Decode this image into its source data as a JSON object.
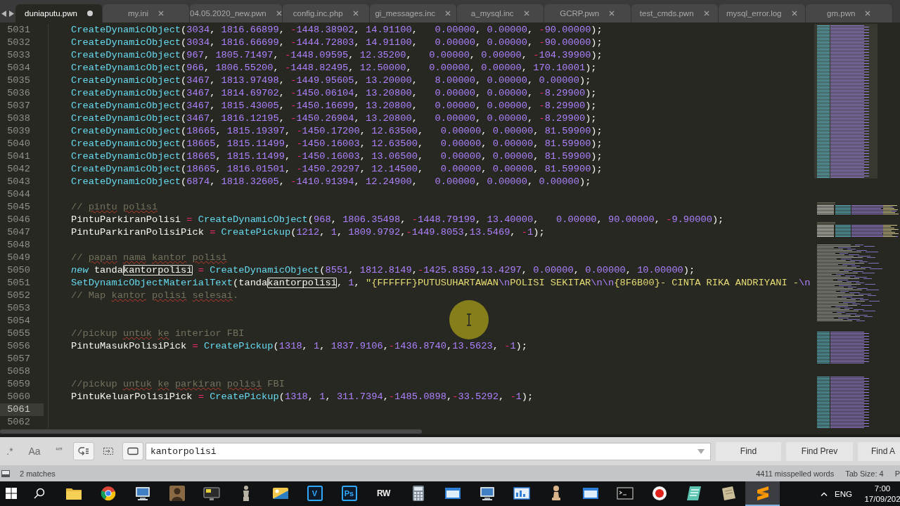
{
  "tabs": [
    {
      "label": "duniaputu.pwn",
      "selected": true,
      "modified": true
    },
    {
      "label": "my.ini",
      "selected": false,
      "modified": false
    },
    {
      "label": "04.05.2020_new.pwn",
      "selected": false,
      "modified": false
    },
    {
      "label": "config.inc.php",
      "selected": false,
      "modified": false
    },
    {
      "label": "gi_messages.inc",
      "selected": false,
      "modified": false
    },
    {
      "label": "a_mysql.inc",
      "selected": false,
      "modified": false
    },
    {
      "label": "GCRP.pwn",
      "selected": false,
      "modified": false
    },
    {
      "label": "test_cmds.pwn",
      "selected": false,
      "modified": false
    },
    {
      "label": "mysql_error.log",
      "selected": false,
      "modified": false
    },
    {
      "label": "gm.pwn",
      "selected": false,
      "modified": false
    }
  ],
  "editor": {
    "lines": [
      {
        "number": "5031",
        "current": false,
        "segments": [
          {
            "kind": "code",
            "text": "CreateDynamicObject(3034, 1816.66899, -1448.38902, 14.91100,   0.00000, 0.00000, -90.00000);",
            "match": false
          }
        ]
      },
      {
        "number": "5032",
        "current": false,
        "segments": [
          {
            "kind": "code",
            "text": "CreateDynamicObject(3034, 1816.66699, -1444.72803, 14.91100,   0.00000, 0.00000, -90.00000);",
            "match": false
          }
        ]
      },
      {
        "number": "5033",
        "current": false,
        "segments": [
          {
            "kind": "code",
            "text": "CreateDynamicObject(967, 1805.71497, -1448.09595, 12.35200,   0.00000, 0.00000, -104.39900);",
            "match": false
          }
        ]
      },
      {
        "number": "5034",
        "current": false,
        "segments": [
          {
            "kind": "code",
            "text": "CreateDynamicObject(966, 1806.55200, -1448.82495, 12.50000,   0.00000, 0.00000, 170.10001);",
            "match": false
          }
        ]
      },
      {
        "number": "5035",
        "current": false,
        "segments": [
          {
            "kind": "code",
            "text": "CreateDynamicObject(3467, 1813.97498, -1449.95605, 13.20000,   8.00000, 0.00000, 0.00000);",
            "match": false
          }
        ]
      },
      {
        "number": "5036",
        "current": false,
        "segments": [
          {
            "kind": "code",
            "text": "CreateDynamicObject(3467, 1814.69702, -1450.06104, 13.20800,   0.00000, 0.00000, -8.29900);",
            "match": false
          }
        ]
      },
      {
        "number": "5037",
        "current": false,
        "segments": [
          {
            "kind": "code",
            "text": "CreateDynamicObject(3467, 1815.43005, -1450.16699, 13.20800,   0.00000, 0.00000, -8.29900);",
            "match": false
          }
        ]
      },
      {
        "number": "5038",
        "current": false,
        "segments": [
          {
            "kind": "code",
            "text": "CreateDynamicObject(3467, 1816.12195, -1450.26904, 13.20800,   0.00000, 0.00000, -8.29900);",
            "match": false
          }
        ]
      },
      {
        "number": "5039",
        "current": false,
        "segments": [
          {
            "kind": "code",
            "text": "CreateDynamicObject(18665, 1815.19397, -1450.17200, 12.63500,   0.00000, 0.00000, 81.59900);",
            "match": false
          }
        ]
      },
      {
        "number": "5040",
        "current": false,
        "segments": [
          {
            "kind": "code",
            "text": "CreateDynamicObject(18665, 1815.11499, -1450.16003, 12.63500,   0.00000, 0.00000, 81.59900);",
            "match": false
          }
        ]
      },
      {
        "number": "5041",
        "current": false,
        "segments": [
          {
            "kind": "code",
            "text": "CreateDynamicObject(18665, 1815.11499, -1450.16003, 13.06500,   0.00000, 0.00000, 81.59900);",
            "match": false
          }
        ]
      },
      {
        "number": "5042",
        "current": false,
        "segments": [
          {
            "kind": "code",
            "text": "CreateDynamicObject(18665, 1816.01501, -1450.29297, 12.14500,   0.00000, 0.00000, 81.59900);",
            "match": false
          }
        ]
      },
      {
        "number": "5043",
        "current": false,
        "segments": [
          {
            "kind": "code",
            "text": "CreateDynamicObject(6874, 1818.32605, -1410.91394, 12.24900,   0.00000, 0.00000, 0.00000);",
            "match": false
          }
        ]
      },
      {
        "number": "5044",
        "current": false
      },
      {
        "number": "5045",
        "current": false,
        "segments": [
          {
            "kind": "comment",
            "text": "// ",
            "misspelled": false
          },
          {
            "kind": "comment",
            "text": "pintu ",
            "misspelled": true
          },
          {
            "kind": "comment",
            "text": "polisi",
            "misspelled": true
          }
        ]
      },
      {
        "number": "5046",
        "current": false,
        "segments": [
          {
            "kind": "code",
            "text": "PintuParkiranPolisi = CreateDynamicObject(968, 1806.35498, -1448.79199, 13.40000,   0.00000, 90.00000, -9.90000);",
            "match": false
          }
        ]
      },
      {
        "number": "5047",
        "current": false,
        "segments": [
          {
            "kind": "code",
            "text": "PintuParkiranPolisiPick = CreatePickup(1212, 1, 1809.9792,-1449.8053,13.5469, -1);",
            "match": false
          }
        ]
      },
      {
        "number": "5048",
        "current": false
      },
      {
        "number": "5049",
        "current": false,
        "segments": [
          {
            "kind": "comment",
            "text": "// ",
            "misspelled": false
          },
          {
            "kind": "comment",
            "text": "papan ",
            "misspelled": true
          },
          {
            "kind": "comment",
            "text": "nama ",
            "misspelled": true
          },
          {
            "kind": "comment",
            "text": "kantor ",
            "misspelled": true
          },
          {
            "kind": "comment",
            "text": "polisi",
            "misspelled": true
          }
        ]
      },
      {
        "number": "5050",
        "current": false,
        "segments": [
          {
            "kind": "keyword",
            "text": "new"
          },
          {
            "kind": "code",
            "text": " tanda",
            "match": false
          },
          {
            "kind": "code",
            "text": "kantorpolisi",
            "match": true
          },
          {
            "kind": "code",
            "text": " = CreateDynamicObject(8551, 1812.8149,-1425.8359,13.4297, 0.00000, 0.00000, 10.00000);",
            "match": false
          }
        ]
      },
      {
        "number": "5051",
        "current": false,
        "segments": [
          {
            "kind": "code",
            "text": "SetDynamicObjectMaterialText(tanda",
            "match": false
          },
          {
            "kind": "code",
            "text": "kantorpolisi",
            "match": true
          },
          {
            "kind": "code",
            "text": ", 1, \"{FFFFFF}PUTUSUHARTAWAN\\nPOLISI SEKITAR\\n\\n{8F6B00}- CINTA RIKA ANDRIYANI -\\n",
            "match": false
          }
        ]
      },
      {
        "number": "5052",
        "current": false,
        "segments": [
          {
            "kind": "comment",
            "text": "// Map ",
            "misspelled": false
          },
          {
            "kind": "comment",
            "text": "kantor ",
            "misspelled": true
          },
          {
            "kind": "comment",
            "text": "polisi ",
            "misspelled": true
          },
          {
            "kind": "comment",
            "text": "selesai",
            "misspelled": true
          },
          {
            "kind": "comment",
            "text": ".",
            "misspelled": false
          }
        ]
      },
      {
        "number": "5053",
        "current": false
      },
      {
        "number": "5054",
        "current": false
      },
      {
        "number": "5055",
        "current": false,
        "segments": [
          {
            "kind": "comment",
            "text": "//pickup ",
            "misspelled": false
          },
          {
            "kind": "comment",
            "text": "untuk ",
            "misspelled": true
          },
          {
            "kind": "comment",
            "text": "ke",
            "misspelled": true
          },
          {
            "kind": "comment",
            "text": " interior FBI",
            "misspelled": false
          }
        ]
      },
      {
        "number": "5056",
        "current": false,
        "segments": [
          {
            "kind": "code",
            "text": "PintuMasukPolisiPick = CreatePickup(1318, 1, 1837.9106,-1436.8740,13.5623, -1);",
            "match": false
          }
        ]
      },
      {
        "number": "5057",
        "current": false
      },
      {
        "number": "5058",
        "current": false
      },
      {
        "number": "5059",
        "current": false,
        "segments": [
          {
            "kind": "comment",
            "text": "//pickup ",
            "misspelled": false
          },
          {
            "kind": "comment",
            "text": "untuk ",
            "misspelled": true
          },
          {
            "kind": "comment",
            "text": "ke ",
            "misspelled": true
          },
          {
            "kind": "comment",
            "text": "parkiran ",
            "misspelled": true
          },
          {
            "kind": "comment",
            "text": "polisi",
            "misspelled": true
          },
          {
            "kind": "comment",
            "text": " FBI",
            "misspelled": false
          }
        ]
      },
      {
        "number": "5060",
        "current": false,
        "segments": [
          {
            "kind": "code",
            "text": "PintuKeluarPolisiPick = CreatePickup(1318, 1, 311.7394,-1485.0898,-33.5292, -1);",
            "match": false
          }
        ]
      },
      {
        "number": "5061",
        "current": true
      },
      {
        "number": "5062",
        "current": false
      }
    ]
  },
  "find": {
    "options": [
      {
        "kind": "regex",
        "label": ".*",
        "selected": false
      },
      {
        "kind": "case",
        "label": "Aa",
        "selected": false
      },
      {
        "kind": "word",
        "label": "“”",
        "selected": false
      },
      {
        "kind": "wrap",
        "selected": true
      },
      {
        "kind": "selection",
        "selected": false
      },
      {
        "kind": "highlight",
        "selected": true
      }
    ],
    "field": {
      "value": "kantorpolisi"
    },
    "buttons": [
      "Find",
      "Find Prev",
      "Find A"
    ]
  },
  "status_bar": {
    "matches": "2 matches",
    "items": [
      "4411 misspelled words",
      "Tab Size: 4",
      "P"
    ]
  },
  "taskbar": {
    "apps": [
      {
        "kind": "folder",
        "selected": false
      },
      {
        "kind": "ring",
        "selected": false
      },
      {
        "kind": "computer",
        "selected": false
      },
      {
        "kind": "portrait",
        "selected": false
      },
      {
        "kind": "monitor",
        "selected": false
      },
      {
        "kind": "statue",
        "selected": false
      },
      {
        "kind": "card",
        "selected": false
      },
      {
        "kind": "tile",
        "glyph": "V",
        "selected": false
      },
      {
        "kind": "tile",
        "glyph": "Ps",
        "selected": false
      },
      {
        "kind": "lettermark",
        "glyph": "RW",
        "selected": false
      },
      {
        "kind": "calculator",
        "selected": false
      },
      {
        "kind": "window",
        "selected": false
      },
      {
        "kind": "computer",
        "selected": false
      },
      {
        "kind": "panel",
        "selected": false
      },
      {
        "kind": "pawn",
        "selected": false
      },
      {
        "kind": "window",
        "selected": false
      },
      {
        "kind": "terminal",
        "selected": false
      },
      {
        "kind": "record",
        "selected": false
      },
      {
        "kind": "notepad",
        "selected": false
      },
      {
        "kind": "paper",
        "selected": false
      },
      {
        "kind": "bands",
        "selected": true
      }
    ],
    "language": "ENG",
    "time": "7:00",
    "date": "17/09/202"
  }
}
